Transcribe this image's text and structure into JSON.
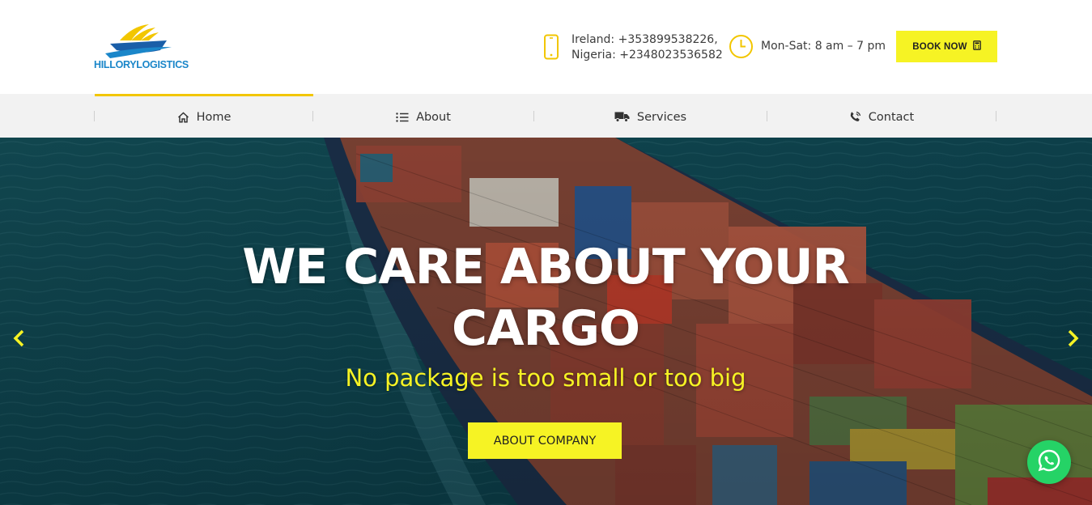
{
  "header": {
    "logo_text": "HILLORYLOGISTICS",
    "contact": {
      "icon": "mobile-phone-icon",
      "line1": "Ireland: +353899538226,",
      "line2": "Nigeria: +2348023536582"
    },
    "hours": {
      "icon": "clock-icon",
      "text": "Mon-Sat: 8 am – 7 pm"
    },
    "book_button": {
      "label": "BOOK NOW",
      "icon": "calculator-icon"
    }
  },
  "nav": {
    "active_index": 0,
    "items": [
      {
        "label": "Home",
        "icon": "home-icon"
      },
      {
        "label": "About",
        "icon": "list-icon"
      },
      {
        "label": "Services",
        "icon": "truck-icon"
      },
      {
        "label": "Contact",
        "icon": "phone-call-icon"
      }
    ]
  },
  "hero": {
    "title_line1": "WE CARE ABOUT YOUR",
    "title_line2": "CARGO",
    "subtitle": "No package is too small or too big",
    "button_label": "ABOUT COMPANY",
    "prev_icon": "chevron-left-icon",
    "next_icon": "chevron-right-icon"
  },
  "floating": {
    "whatsapp_icon": "whatsapp-icon"
  },
  "colors": {
    "accent": "#f6f324",
    "brand_blue": "#1a86c9",
    "brand_gold": "#f2c600",
    "nav_bg": "#f2f2f2",
    "whatsapp": "#25d366"
  }
}
